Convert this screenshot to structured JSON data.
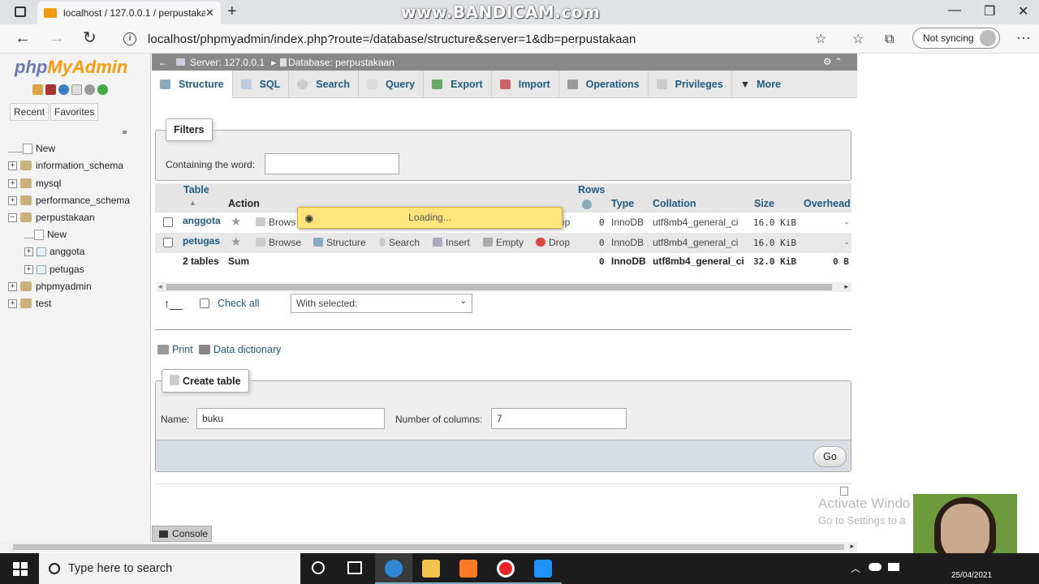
{
  "browser": {
    "tab_title": "localhost / 127.0.0.1 / perpustaka",
    "url": "localhost/phpmyadmin/index.php?route=/database/structure&server=1&db=perpustakaan",
    "sync_label": "Not syncing",
    "watermark": "www.BANDICAM.com"
  },
  "left": {
    "logo_php": "php",
    "logo_my": "MyAdmin",
    "recent": "Recent",
    "favorites": "Favorites",
    "tree": [
      {
        "label": "New",
        "type": "new"
      },
      {
        "label": "information_schema",
        "type": "db"
      },
      {
        "label": "mysql",
        "type": "db"
      },
      {
        "label": "performance_schema",
        "type": "db"
      },
      {
        "label": "perpustakaan",
        "type": "db-open"
      },
      {
        "label": "New",
        "type": "new-child"
      },
      {
        "label": "anggota",
        "type": "table"
      },
      {
        "label": "petugas",
        "type": "table"
      },
      {
        "label": "phpmyadmin",
        "type": "db"
      },
      {
        "label": "test",
        "type": "db"
      }
    ]
  },
  "breadcrumb": {
    "server": "Server: 127.0.0.1",
    "database": "Database: perpustakaan"
  },
  "tabs": [
    "Structure",
    "SQL",
    "Search",
    "Query",
    "Export",
    "Import",
    "Operations",
    "Privileges",
    "More"
  ],
  "filters": {
    "legend": "Filters",
    "label": "Containing the word:",
    "value": ""
  },
  "table": {
    "headers": {
      "table": "Table",
      "action": "Action",
      "rows": "Rows",
      "type": "Type",
      "collation": "Collation",
      "size": "Size",
      "overhead": "Overhead"
    },
    "actions": [
      "Browse",
      "Structure",
      "Search",
      "Insert",
      "Empty",
      "Drop"
    ],
    "rows": [
      {
        "name": "anggota",
        "rows": "0",
        "type": "InnoDB",
        "collation": "utf8mb4_general_ci",
        "size": "16.0 KiB",
        "overhead": "-",
        "tail": "op"
      },
      {
        "name": "petugas",
        "rows": "0",
        "type": "InnoDB",
        "collation": "utf8mb4_general_ci",
        "size": "16.0 KiB",
        "overhead": "-"
      }
    ],
    "sum": {
      "name": "2 tables",
      "label": "Sum",
      "rows": "0",
      "type": "InnoDB",
      "collation": "utf8mb4_general_ci",
      "size": "32.0 KiB",
      "overhead": "0 B"
    },
    "first_row_partial": "Brows",
    "loading": "Loading..."
  },
  "bulk": {
    "check_all": "Check all",
    "with_selected": "With selected:"
  },
  "links": {
    "print": "Print",
    "data_dictionary": "Data dictionary"
  },
  "create": {
    "legend": "Create table",
    "name_label": "Name:",
    "name_value": "buku",
    "cols_label": "Number of columns:",
    "cols_value": "7",
    "go": "Go"
  },
  "console": "Console",
  "activate": {
    "line1": "Activate Windo",
    "line2": "Go to Settings to a"
  },
  "taskbar": {
    "search": "Type here to search",
    "date": "25/04/2021"
  }
}
